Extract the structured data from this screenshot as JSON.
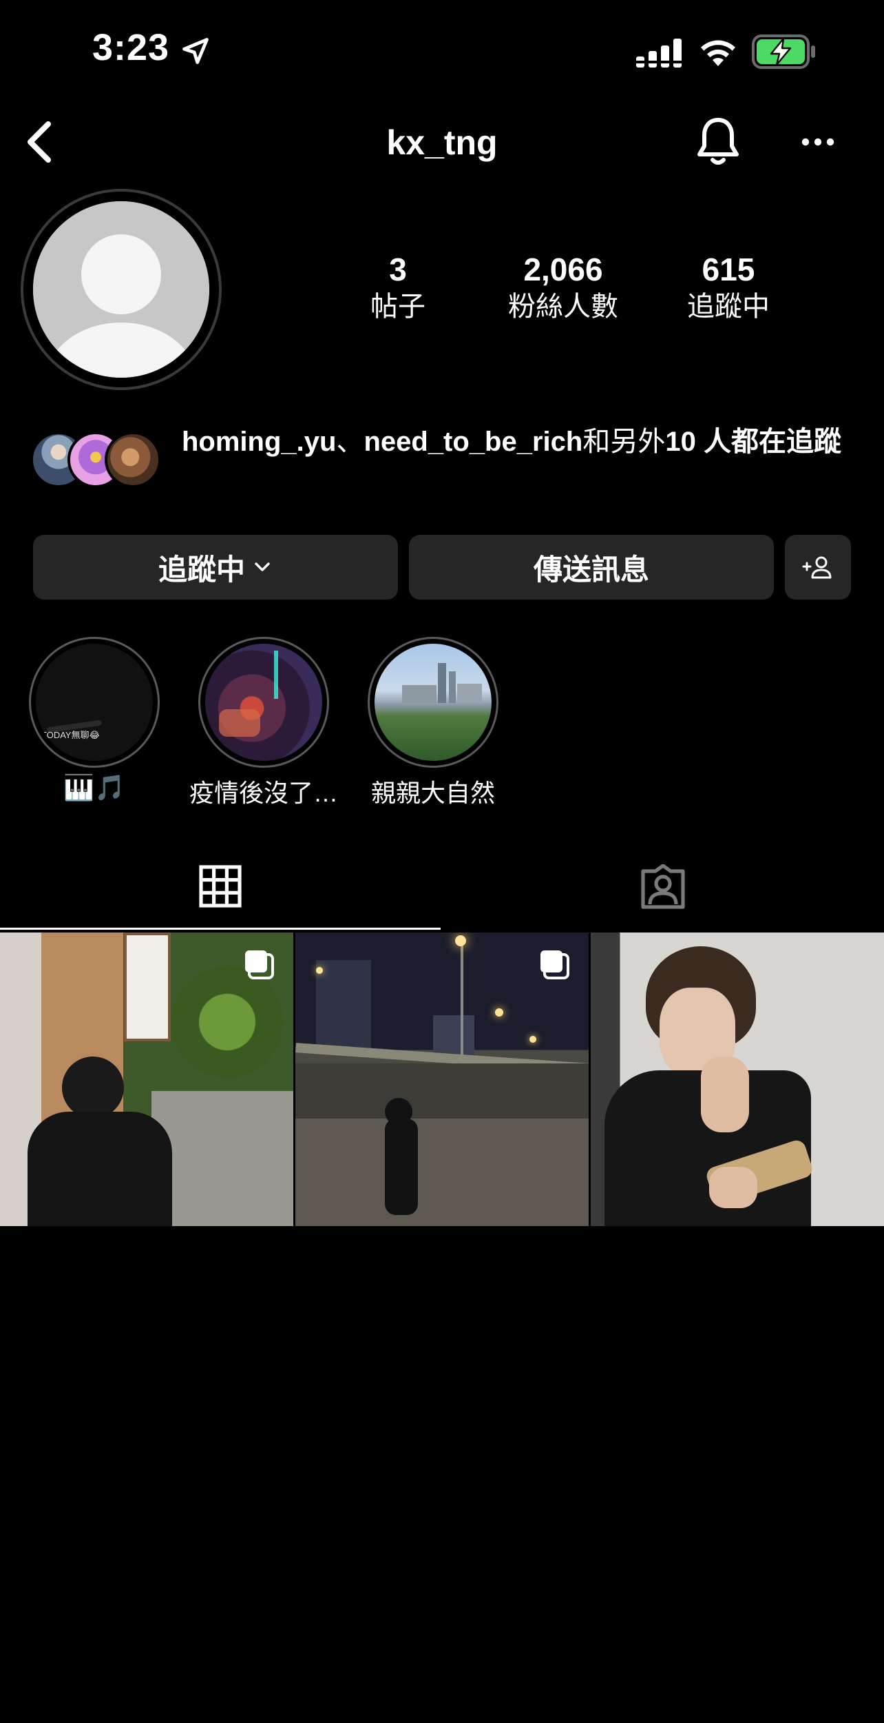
{
  "status_bar": {
    "time": "3:23"
  },
  "header": {
    "username": "kx_tng"
  },
  "stats": [
    {
      "num": "3",
      "label": "帖子"
    },
    {
      "num": "2,066",
      "label": "粉絲人數"
    },
    {
      "num": "615",
      "label": "追蹤中"
    }
  ],
  "mutual": {
    "user1": "homing_.yu",
    "sep": "、",
    "user2": "need_to_be_rich",
    "mid": "和另外",
    "count": "10",
    "tail": "人都在追蹤"
  },
  "buttons": {
    "following": "追蹤中",
    "message": "傳送訊息"
  },
  "highlights": [
    {
      "label": "🎹🎵",
      "caption": "TODAY無聊😂"
    },
    {
      "label": "疫情後沒了…"
    },
    {
      "label": "親親大自然"
    }
  ],
  "icons": {
    "back": "chevron-left-icon",
    "bell": "bell-icon",
    "more": "more-icon",
    "add_user": "add-person-icon",
    "grid": "grid-icon",
    "tagged": "tagged-person-icon"
  }
}
